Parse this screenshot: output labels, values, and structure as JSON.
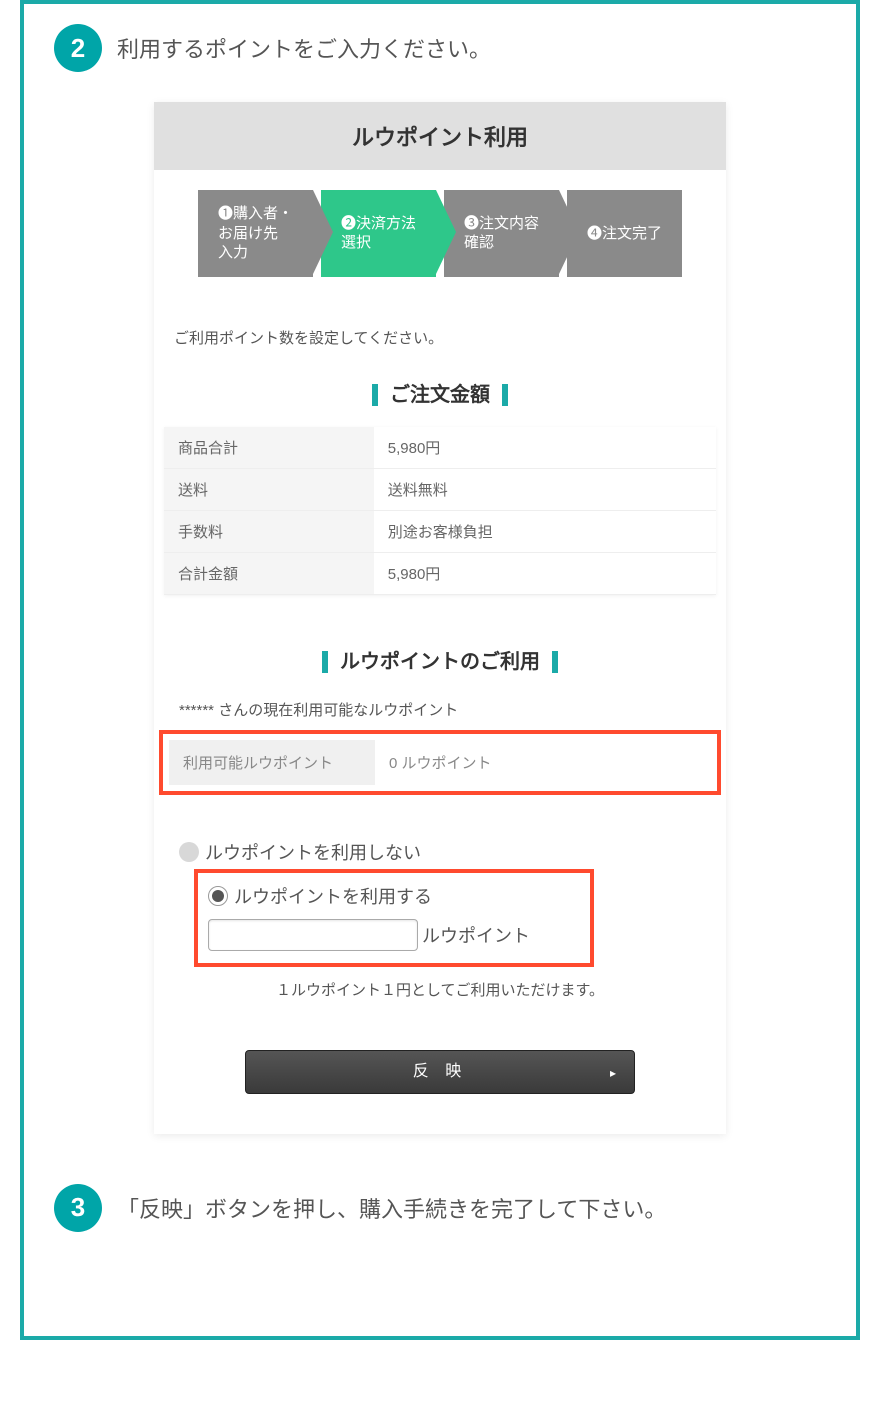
{
  "step2": {
    "number": "2",
    "text": "利用するポイントをご入力ください。"
  },
  "step3": {
    "number": "3",
    "text": "「反映」ボタンを押し、購入手続きを完了して下さい。"
  },
  "card": {
    "title": "ルウポイント利用",
    "breadcrumb": [
      {
        "num": "❶",
        "label": "購入者・\nお届け先\n入力"
      },
      {
        "num": "❷",
        "label": "決済方法\n選択"
      },
      {
        "num": "❸",
        "label": "注文内容\n確認"
      },
      {
        "num": "❹",
        "label": "注文完了"
      }
    ],
    "instruction": "ご利用ポイント数を設定してください。",
    "orderSectionTitle": "ご注文金額",
    "orderTable": [
      {
        "label": "商品合計",
        "value": "5,980円"
      },
      {
        "label": "送料",
        "value": "送料無料"
      },
      {
        "label": "手数料",
        "value": "別途お客様負担"
      },
      {
        "label": "合計金額",
        "value": "5,980円"
      }
    ],
    "pointsSectionTitle": "ルウポイントのご利用",
    "pointsUserText": "****** さんの現在利用可能なルウポイント",
    "pointsTable": {
      "label": "利用可能ルウポイント",
      "value": "0 ルウポイント"
    },
    "radioOptions": {
      "noUse": "ルウポイントを利用しない",
      "use": "ルウポイントを利用する"
    },
    "pointUnit": "ルウポイント",
    "note": "１ルウポイント１円としてご利用いただけます。",
    "applyButton": "反 映"
  }
}
